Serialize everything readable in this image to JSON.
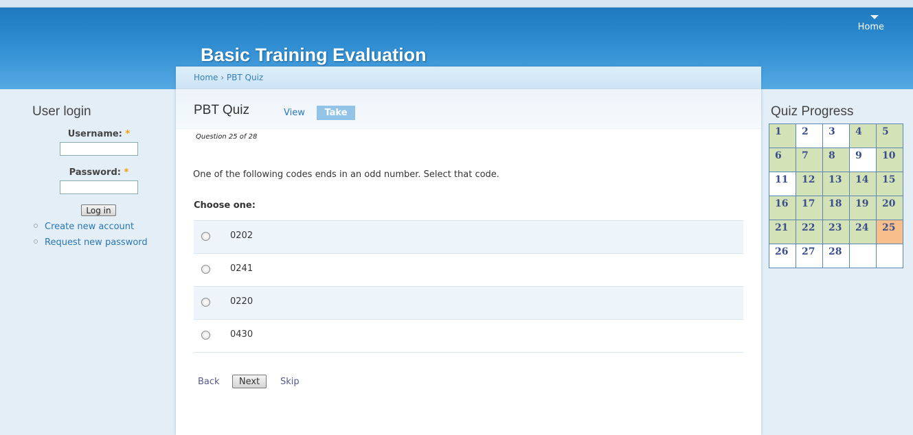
{
  "site": {
    "title": "Basic Training Evaluation",
    "nav_home": "Home"
  },
  "breadcrumb": {
    "home": "Home",
    "separator": "›",
    "current": "PBT Quiz"
  },
  "page": {
    "title": "PBT Quiz",
    "tab_view": "View",
    "tab_take": "Take"
  },
  "quiz": {
    "question_number": "Question 25 of 28",
    "question_text": "One of the following codes ends in an odd number. Select that code.",
    "choose_label": "Choose one:",
    "options": [
      "0202",
      "0241",
      "0220",
      "0430"
    ],
    "back": "Back",
    "next": "Next",
    "skip": "Skip"
  },
  "login": {
    "title": "User login",
    "username_label": "Username:",
    "password_label": "Password:",
    "required_mark": "*",
    "login_button": "Log in",
    "create_account": "Create new account",
    "request_password": "Request new password"
  },
  "progress": {
    "title": "Quiz Progress",
    "colors": {
      "answered": "#d4e2b8",
      "current": "#f7bf8c",
      "unanswered": "#ffffff"
    },
    "rows": [
      [
        {
          "n": "1",
          "s": "answered"
        },
        {
          "n": "2",
          "s": "unanswered"
        },
        {
          "n": "3",
          "s": "unanswered"
        },
        {
          "n": "4",
          "s": "answered"
        },
        {
          "n": "5",
          "s": "answered"
        }
      ],
      [
        {
          "n": "6",
          "s": "answered"
        },
        {
          "n": "7",
          "s": "answered"
        },
        {
          "n": "8",
          "s": "answered"
        },
        {
          "n": "9",
          "s": "unanswered"
        },
        {
          "n": "10",
          "s": "answered"
        }
      ],
      [
        {
          "n": "11",
          "s": "unanswered"
        },
        {
          "n": "12",
          "s": "answered"
        },
        {
          "n": "13",
          "s": "answered"
        },
        {
          "n": "14",
          "s": "answered"
        },
        {
          "n": "15",
          "s": "answered"
        }
      ],
      [
        {
          "n": "16",
          "s": "answered"
        },
        {
          "n": "17",
          "s": "answered"
        },
        {
          "n": "18",
          "s": "answered"
        },
        {
          "n": "19",
          "s": "answered"
        },
        {
          "n": "20",
          "s": "answered"
        }
      ],
      [
        {
          "n": "21",
          "s": "answered"
        },
        {
          "n": "22",
          "s": "answered"
        },
        {
          "n": "23",
          "s": "answered"
        },
        {
          "n": "24",
          "s": "answered"
        },
        {
          "n": "25",
          "s": "current"
        }
      ],
      [
        {
          "n": "26",
          "s": "unanswered"
        },
        {
          "n": "27",
          "s": "unanswered"
        },
        {
          "n": "28",
          "s": "unanswered"
        },
        {
          "n": "",
          "s": "unanswered"
        },
        {
          "n": "",
          "s": "unanswered"
        }
      ]
    ]
  }
}
